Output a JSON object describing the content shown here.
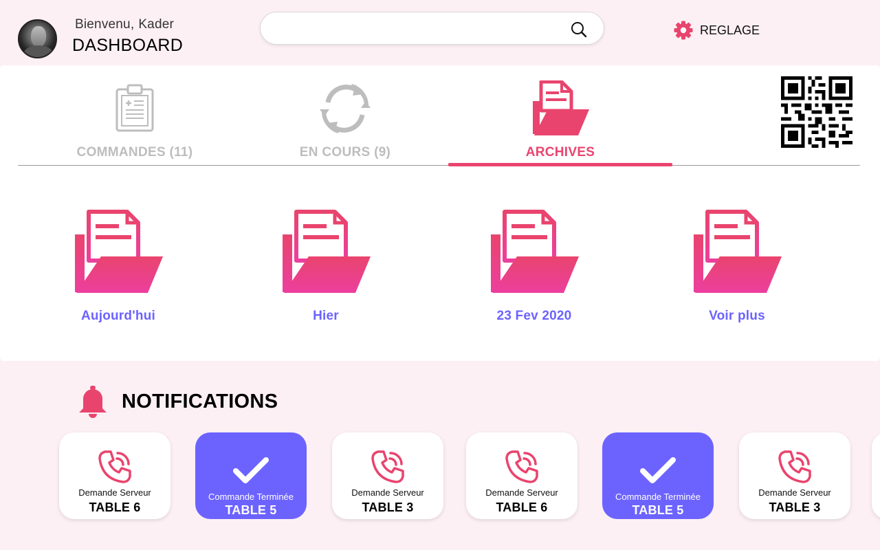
{
  "header": {
    "greeting_word": "Bienvenu,",
    "user_name": "Kader",
    "title": "DASHBOARD",
    "search_placeholder": "",
    "settings_label": "REGLAGE"
  },
  "tabs": [
    {
      "label": "COMMANDES (11)",
      "icon": "clipboard-icon",
      "active": false
    },
    {
      "label": "EN COURS (9)",
      "icon": "sync-icon",
      "active": false
    },
    {
      "label": "ARCHIVES",
      "icon": "archive-folder-icon",
      "active": true
    }
  ],
  "archives": [
    {
      "label": "Aujourd'hui"
    },
    {
      "label": "Hier"
    },
    {
      "label": "23 Fev 2020"
    },
    {
      "label": "Voir plus"
    }
  ],
  "notifications": {
    "title": "NOTIFICATIONS",
    "items": [
      {
        "type": "request",
        "text": "Demande Serveur",
        "table": "TABLE 6"
      },
      {
        "type": "done",
        "text": "Commande Terminée",
        "table": "TABLE 5"
      },
      {
        "type": "request",
        "text": "Demande Serveur",
        "table": "TABLE 3"
      },
      {
        "type": "request",
        "text": "Demande Serveur",
        "table": "TABLE 6"
      },
      {
        "type": "done",
        "text": "Commande Terminée",
        "table": "TABLE 5"
      },
      {
        "type": "request",
        "text": "Demande Serveur",
        "table": "TABLE 3"
      }
    ]
  },
  "colors": {
    "accent": "#e9446e",
    "purple": "#6c63ff",
    "background": "#fdf0f4",
    "inactive": "#bdbdbd"
  }
}
